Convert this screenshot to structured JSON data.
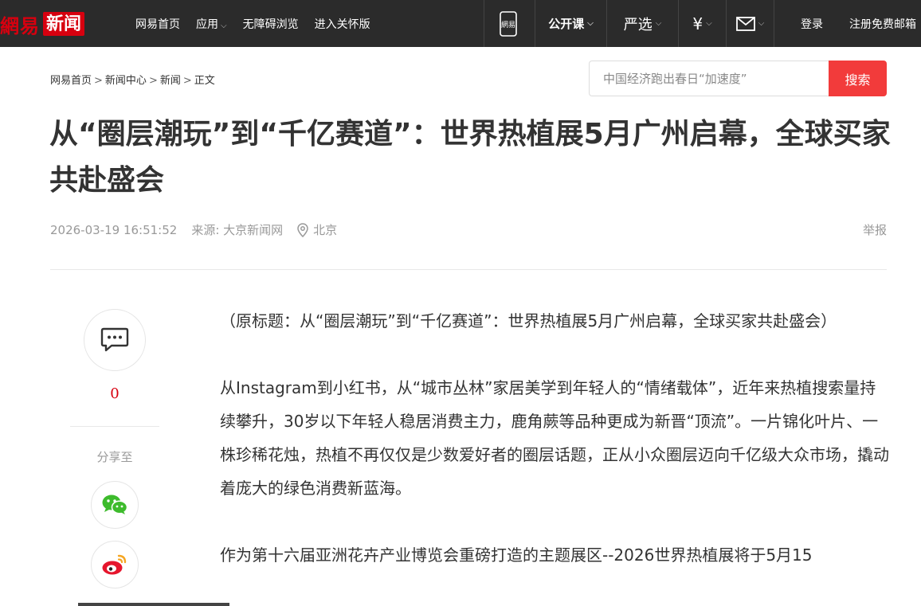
{
  "topbar": {
    "logo_part1": "網易",
    "logo_part2": "新闻",
    "nav": [
      {
        "label": "网易首页",
        "has_caret": false
      },
      {
        "label": "应用",
        "has_caret": true
      },
      {
        "label": "无障碍浏览",
        "has_caret": false
      },
      {
        "label": "进入关怀版",
        "has_caret": false
      }
    ],
    "right": {
      "phone_label": "網易",
      "open_course": "公开课",
      "yanxuan": "严选",
      "money_icon": "¥",
      "login": "登录",
      "register": "注册免费邮箱"
    }
  },
  "breadcrumb": [
    "网易首页",
    "新闻中心",
    "新闻",
    "正文"
  ],
  "breadcrumb_sep": ">",
  "search": {
    "placeholder": "中国经济跑出春日“加速度”",
    "button": "搜索"
  },
  "article": {
    "title": "从“圈层潮玩”到“千亿赛道”：世界热植展5月广州启幕，全球买家共赴盛会",
    "datetime": "2026-03-19 16:51:52",
    "source": "来源: 大京新闻网",
    "location": "北京",
    "report": "举报",
    "paragraphs": [
      "（原标题：从“圈层潮玩”到“千亿赛道”：世界热植展5月广州启幕，全球买家共赴盛会）",
      "从Instagram到小红书，从“城市丛林”家居美学到年轻人的“情绪载体”，近年来热植搜索量持续攀升，30岁以下年轻人稳居消费主力，鹿角蕨等品种更成为新晋“顶流”。一片锦化叶片、一株珍稀花烛，热植不再仅仅是少数爱好者的圈层话题，正从小众圈层迈向千亿级大众市场，撬动着庞大的绿色消费新蓝海。",
      "作为第十六届亚洲花卉产业博览会重磅打造的主题展区--2026世界热植展将于5月15"
    ]
  },
  "share": {
    "comment_count": "0",
    "label": "分享至"
  },
  "colors": {
    "brand_red": "#d7000f",
    "search_button": "#f23b3b",
    "topbar_bg": "#2b2b2b"
  }
}
